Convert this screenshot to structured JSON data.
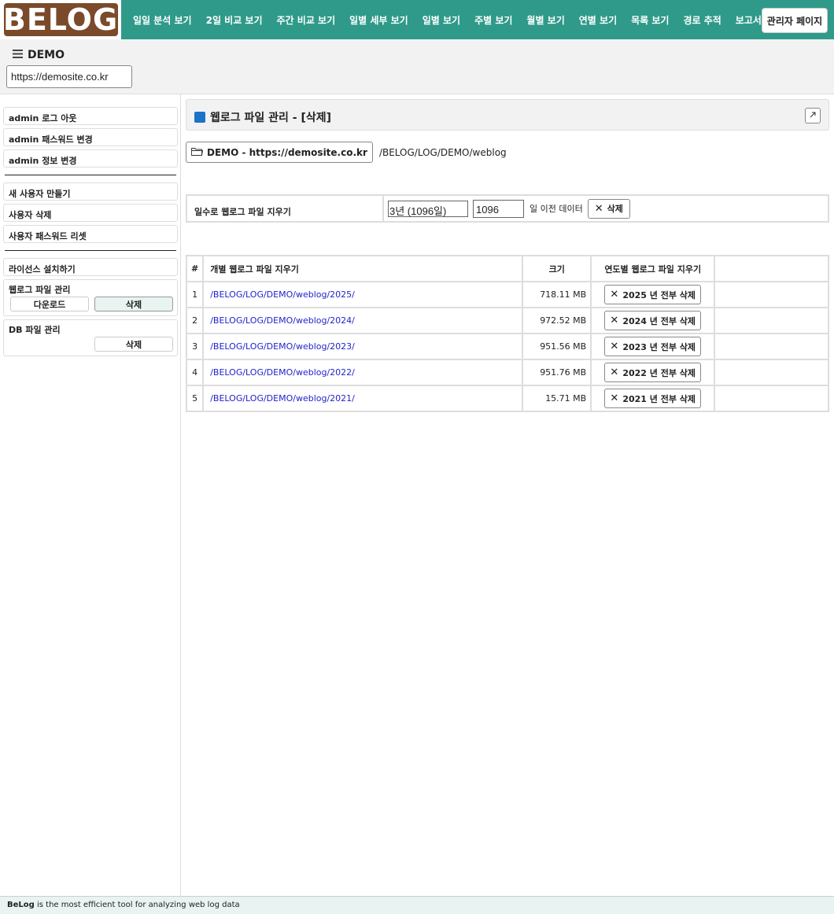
{
  "logo": {
    "text": "BELOG"
  },
  "nav": {
    "items": [
      "일일 분석 보기",
      "2일 비교 보기",
      "주간 비교 보기",
      "일별 세부 보기",
      "일별 보기",
      "주별 보기",
      "월별 보기",
      "연별 보기",
      "목록 보기",
      "경로 추적",
      "보고서"
    ],
    "admin_label": "관리자 페이지"
  },
  "site": {
    "name": "DEMO",
    "url": "https://demosite.co.kr",
    "menu_icon": "hamburger-icon"
  },
  "sidebar": {
    "group1": [
      "admin 로그 아웃",
      "admin 패스워드 변경",
      "admin 정보 변경"
    ],
    "group2": [
      "새 사용자 만들기",
      "사용자 삭제",
      "사용자 패스워드 리셋"
    ],
    "license": "라이선스 설치하기",
    "weblog": {
      "title": "웹로그 파일 관리",
      "download": "다운로드",
      "delete": "삭제"
    },
    "db": {
      "title": "DB 파일 관리",
      "delete": "삭제"
    }
  },
  "panel": {
    "title": "웹로그 파일 관리 - [삭제]",
    "folder_button": "DEMO - https://demosite.co.kr",
    "path": "/BELOG/LOG/DEMO/weblog"
  },
  "days_delete": {
    "label": "일수로 웹로그 파일 지우기",
    "selected_option": "3년 (1096일)",
    "days_value": "1096",
    "suffix": "일 이전 데이터",
    "button": "삭제"
  },
  "files": {
    "headers": {
      "num": "#",
      "path": "개별 웹로그 파일 지우기",
      "size": "크기",
      "year_delete": "연도별 웹로그 파일 지우기",
      "extra": ""
    },
    "rows": [
      {
        "num": "1",
        "path": "/BELOG/LOG/DEMO/weblog/2025/",
        "size": "718.11 MB",
        "button": "2025 년 전부 삭제"
      },
      {
        "num": "2",
        "path": "/BELOG/LOG/DEMO/weblog/2024/",
        "size": "972.52 MB",
        "button": "2024 년 전부 삭제"
      },
      {
        "num": "3",
        "path": "/BELOG/LOG/DEMO/weblog/2023/",
        "size": "951.56 MB",
        "button": "2023 년 전부 삭제"
      },
      {
        "num": "4",
        "path": "/BELOG/LOG/DEMO/weblog/2022/",
        "size": "951.76 MB",
        "button": "2022 년 전부 삭제"
      },
      {
        "num": "5",
        "path": "/BELOG/LOG/DEMO/weblog/2021/",
        "size": "15.71 MB",
        "button": "2021 년 전부 삭제"
      }
    ]
  },
  "footer": {
    "brand": "BeLog",
    "text": " is the most efficient tool for analyzing web log data"
  },
  "colors": {
    "nav_bg": "#2f9a8a",
    "logo_bg": "#7a4a2a",
    "link": "#2222cc",
    "title_icon": "#1a73c9"
  }
}
